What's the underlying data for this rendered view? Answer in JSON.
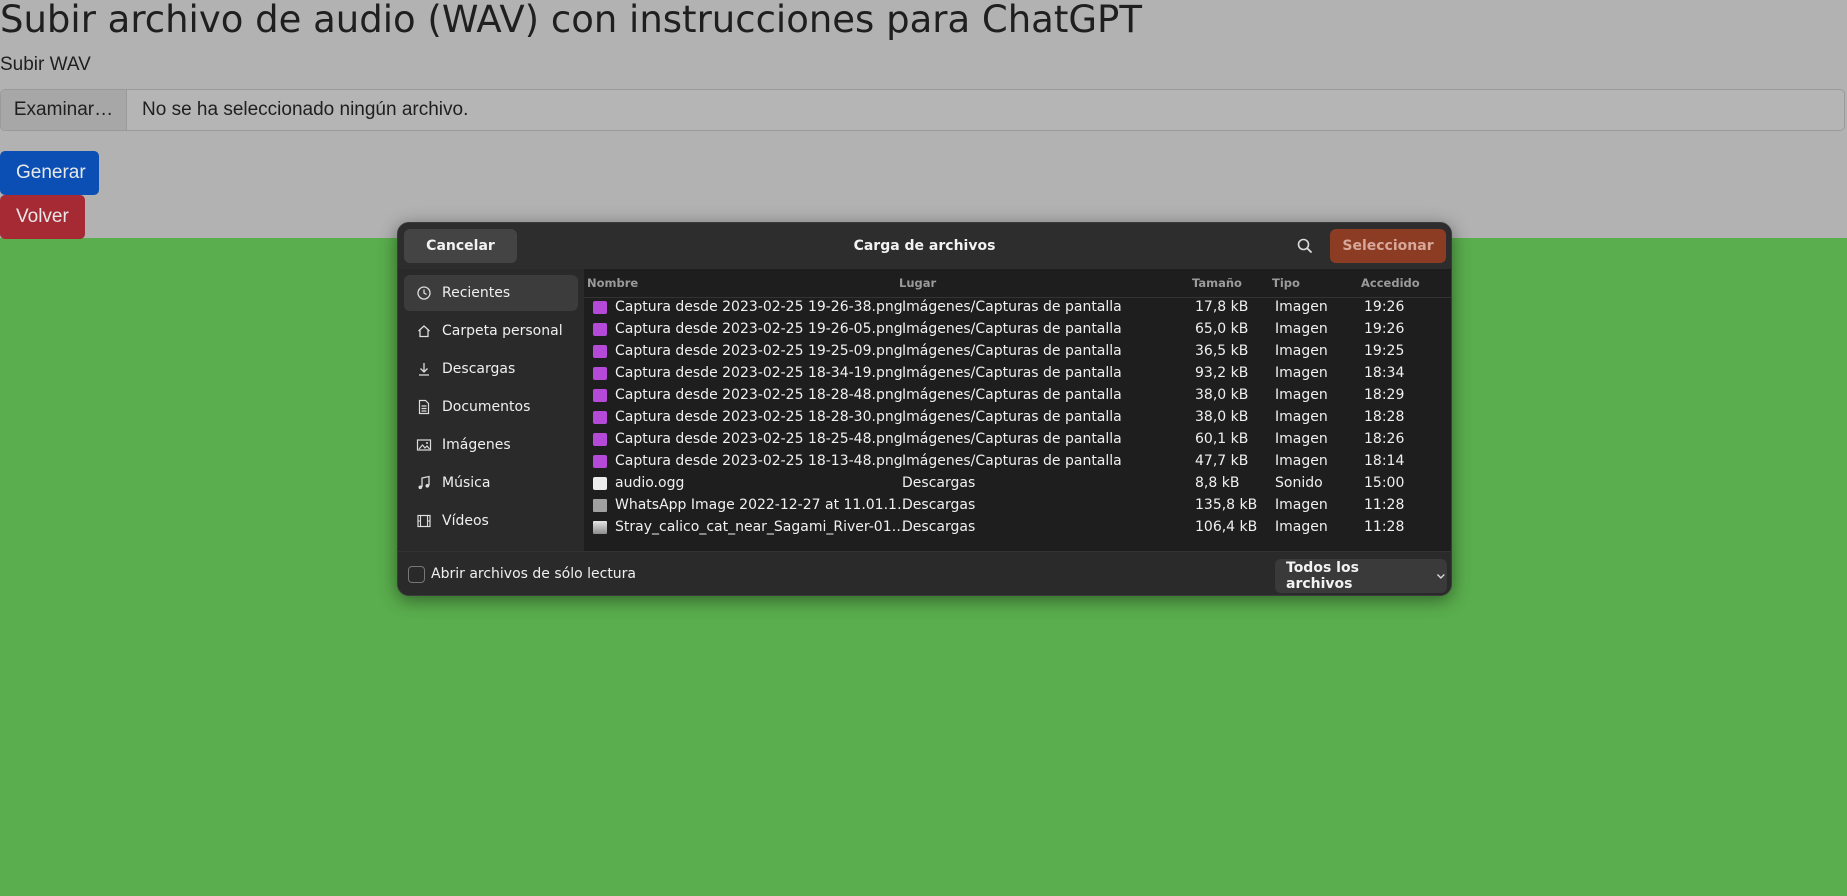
{
  "page": {
    "title": "Subir archivo de audio (WAV) con instrucciones para ChatGPT",
    "upload_label": "Subir WAV",
    "browse_label": "Examinar…",
    "file_status": "No se ha seleccionado ningún archivo.",
    "generate_label": "Generar",
    "back_label": "Volver"
  },
  "dialog": {
    "cancel_label": "Cancelar",
    "title": "Carga de archivos",
    "select_label": "Seleccionar",
    "sidebar": [
      {
        "label": "Recientes",
        "icon": "clock-icon",
        "active": true
      },
      {
        "label": "Carpeta personal",
        "icon": "home-icon"
      },
      {
        "label": "Descargas",
        "icon": "download-icon"
      },
      {
        "label": "Documentos",
        "icon": "document-icon"
      },
      {
        "label": "Imágenes",
        "icon": "image-icon"
      },
      {
        "label": "Música",
        "icon": "music-icon"
      },
      {
        "label": "Vídeos",
        "icon": "video-icon"
      }
    ],
    "columns": {
      "name": "Nombre",
      "place": "Lugar",
      "size": "Tamaño",
      "type": "Tipo",
      "accessed": "Accedido"
    },
    "files": [
      {
        "name": "Captura desde 2023-02-25 19-26-38.png",
        "place": "Imágenes/Capturas de pantalla",
        "size": "17,8 kB",
        "type": "Imagen",
        "accessed": "19:26",
        "icon": "image-file-icon"
      },
      {
        "name": "Captura desde 2023-02-25 19-26-05.png",
        "place": "Imágenes/Capturas de pantalla",
        "size": "65,0 kB",
        "type": "Imagen",
        "accessed": "19:26",
        "icon": "image-file-icon"
      },
      {
        "name": "Captura desde 2023-02-25 19-25-09.png",
        "place": "Imágenes/Capturas de pantalla",
        "size": "36,5 kB",
        "type": "Imagen",
        "accessed": "19:25",
        "icon": "image-file-icon"
      },
      {
        "name": "Captura desde 2023-02-25 18-34-19.png",
        "place": "Imágenes/Capturas de pantalla",
        "size": "93,2 kB",
        "type": "Imagen",
        "accessed": "18:34",
        "icon": "image-file-icon"
      },
      {
        "name": "Captura desde 2023-02-25 18-28-48.png",
        "place": "Imágenes/Capturas de pantalla",
        "size": "38,0 kB",
        "type": "Imagen",
        "accessed": "18:29",
        "icon": "image-file-icon"
      },
      {
        "name": "Captura desde 2023-02-25 18-28-30.png",
        "place": "Imágenes/Capturas de pantalla",
        "size": "38,0 kB",
        "type": "Imagen",
        "accessed": "18:28",
        "icon": "image-file-icon"
      },
      {
        "name": "Captura desde 2023-02-25 18-25-48.png",
        "place": "Imágenes/Capturas de pantalla",
        "size": "60,1 kB",
        "type": "Imagen",
        "accessed": "18:26",
        "icon": "image-file-icon"
      },
      {
        "name": "Captura desde 2023-02-25 18-13-48.png",
        "place": "Imágenes/Capturas de pantalla",
        "size": "47,7 kB",
        "type": "Imagen",
        "accessed": "18:14",
        "icon": "image-file-icon"
      },
      {
        "name": "audio.ogg",
        "place": "Descargas",
        "size": "8,8 kB",
        "type": "Sonido",
        "accessed": "15:00",
        "icon": "audio-file-icon"
      },
      {
        "name": "WhatsApp Image 2022-12-27 at 11.01.1…",
        "place": "Descargas",
        "size": "135,8 kB",
        "type": "Imagen",
        "accessed": "11:28",
        "icon": "image-thumbnail-icon"
      },
      {
        "name": "Stray_calico_cat_near_Sagami_River-01…",
        "place": "Descargas",
        "size": "106,4 kB",
        "type": "Imagen",
        "accessed": "11:28",
        "icon": "photo-thumbnail-icon"
      }
    ],
    "readonly_label": "Abrir archivos de sólo lectura",
    "filter_label": "Todos los archivos"
  },
  "colors": {
    "page_background": "#5aae4d",
    "generate_button": "#0b4fb5",
    "back_button": "#a52a33",
    "select_button": "#8d3c24",
    "dialog_background": "#242424"
  }
}
